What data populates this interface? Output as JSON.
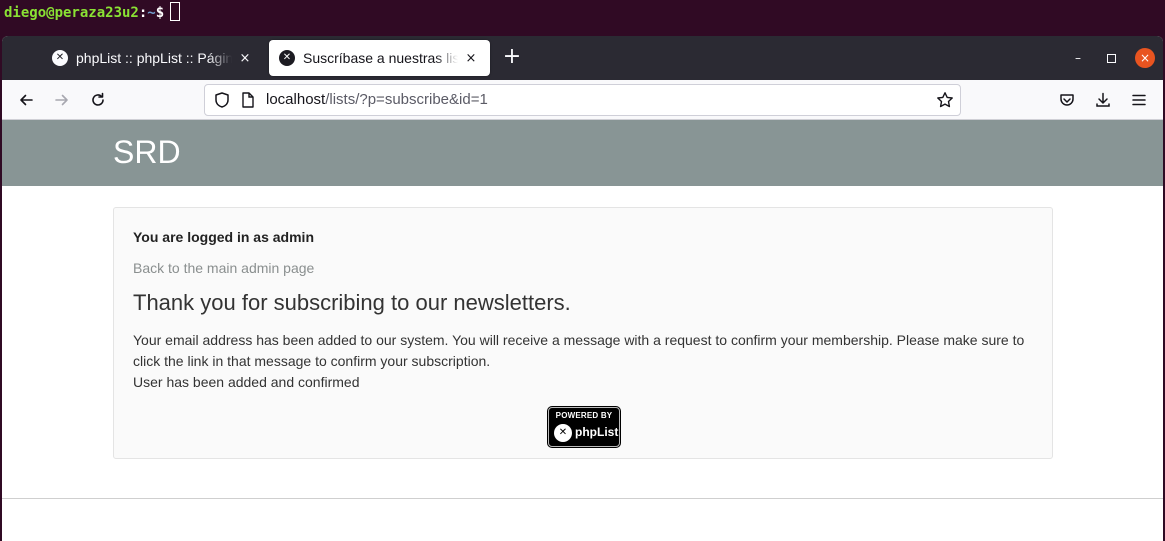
{
  "terminal": {
    "user_host": "diego@peraza23u2",
    "separator": ":",
    "path": "~",
    "prompt": "$"
  },
  "browser": {
    "tabs": [
      {
        "title": "phpList :: phpList :: Página",
        "close_icon": "×",
        "active": false
      },
      {
        "title": "Suscríbase a nuestras lista",
        "close_icon": "×",
        "active": true
      }
    ],
    "new_tab_icon": "+",
    "window_controls": {
      "minimize": "–",
      "close": "×"
    },
    "url": {
      "host": "localhost",
      "path": "/lists/?p=subscribe&id=1"
    }
  },
  "page": {
    "site_title": "SRD",
    "logged_in": "You are logged in as admin",
    "back_link": "Back to the main admin page",
    "heading": "Thank you for subscribing to our newsletters.",
    "message": "Your email address has been added to our system. You will receive a message with a request to confirm your membership. Please make sure to click the link in that message to confirm your subscription.",
    "status": "User has been added and confirmed",
    "badge": {
      "top": "POWERED BY",
      "name": "phpList"
    }
  },
  "colors": {
    "header_bg": "#889595",
    "terminal_bg": "#300a24",
    "terminal_user": "#8ae234",
    "terminal_path": "#729fcf",
    "tabbar_bg": "#2b2a33",
    "close_button": "#e95420"
  }
}
